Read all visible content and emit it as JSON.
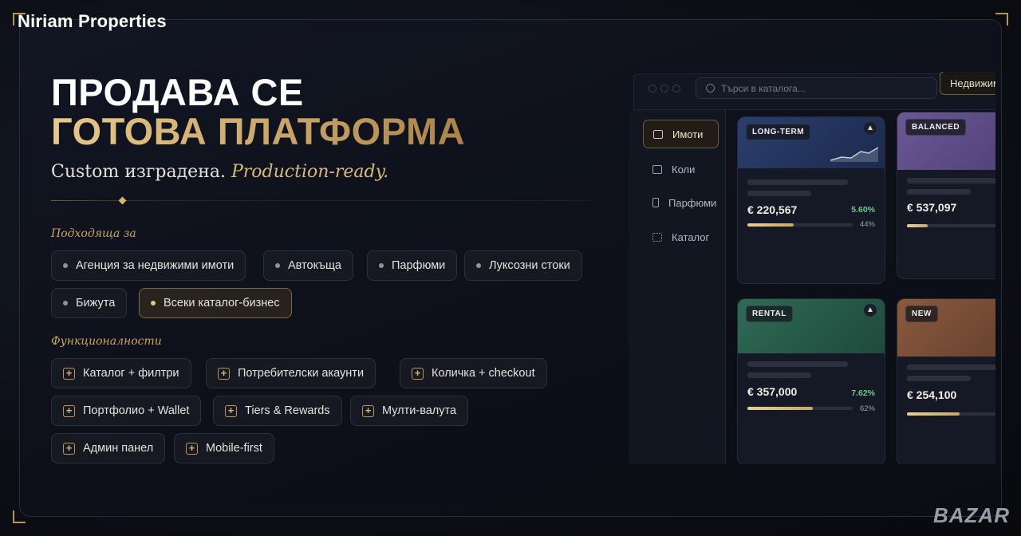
{
  "brand": "Niriam Properties",
  "hero": {
    "line1": "ПРОДАВА СЕ",
    "line2": "ГОТОВА ПЛАТФОРМА",
    "sub_plain": "Custom изградена.",
    "sub_italic": "Production-ready."
  },
  "suitable": {
    "title": "Подходяща за",
    "items": [
      "Агенция за недвижими имоти",
      "Автокъща",
      "Парфюми",
      "Луксозни стоки",
      "Бижута",
      "Всеки каталог-бизнес"
    ],
    "active_index": 5
  },
  "features": {
    "title": "Функционалности",
    "items": [
      "Каталог + филтри",
      "Потребителски акаунти",
      "Количка + checkout",
      "Портфолио + Wallet",
      "Tiers & Rewards",
      "Мулти-валута",
      "Админ панел",
      "Mobile-first"
    ]
  },
  "mockup": {
    "search_placeholder": "Търси в каталога...",
    "top_button": "Недвижим",
    "sidebar": [
      {
        "label": "Имоти",
        "icon": "home-icon",
        "active": true
      },
      {
        "label": "Коли",
        "icon": "car-icon",
        "active": false
      },
      {
        "label": "Парфюми",
        "icon": "bottle-icon",
        "active": false
      },
      {
        "label": "Каталог",
        "icon": "grid-icon",
        "active": false
      }
    ],
    "cards": [
      {
        "tag": "LONG-TERM",
        "price": "€ 220,567",
        "change": "5.60%",
        "progress": "44%",
        "fill": 0.44,
        "color": "#2a3f6e"
      },
      {
        "tag": "BALANCED",
        "price": "€ 537,097",
        "change": "",
        "progress": "",
        "fill": 0.2,
        "color": "#5d4b86"
      },
      {
        "tag": "RENTAL",
        "price": "€ 357,000",
        "change": "7.62%",
        "progress": "62%",
        "fill": 0.62,
        "color": "#2b5c4a"
      },
      {
        "tag": "NEW",
        "price": "€ 254,100",
        "change": "",
        "progress": "",
        "fill": 0.5,
        "color": "#7a4d35"
      }
    ]
  },
  "watermark": "BAZAR",
  "colors": {
    "gold": "#d6b46e",
    "green": "#6fca8d"
  }
}
